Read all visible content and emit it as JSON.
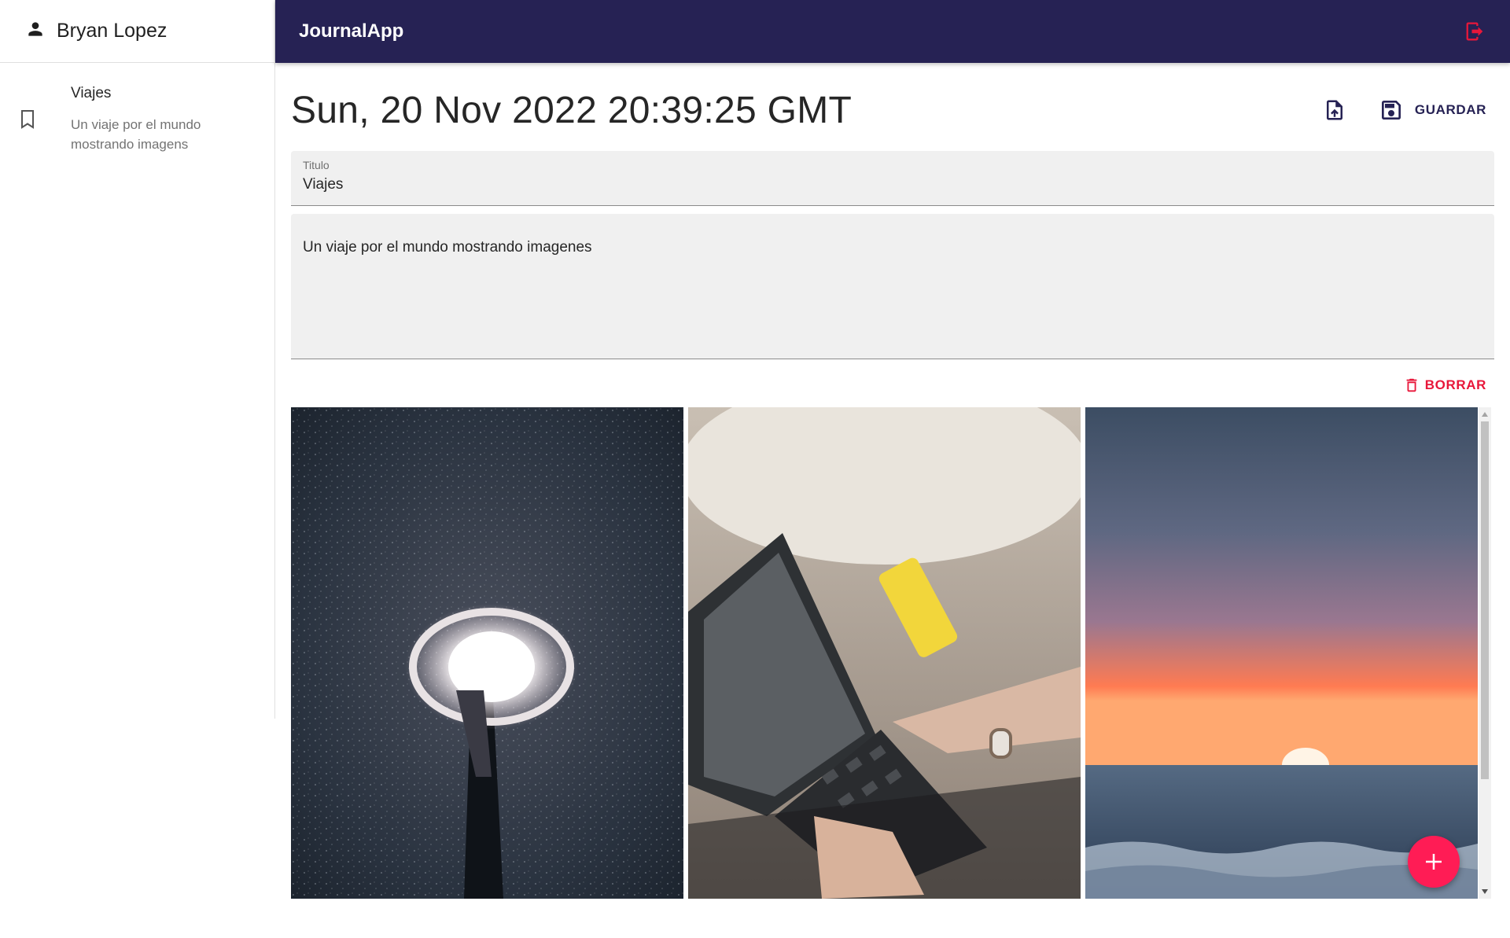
{
  "sidebar": {
    "user_name": "Bryan Lopez",
    "user_icon": "person-icon",
    "entries": [
      {
        "title": "Viajes",
        "body": "Un viaje por el mundo mostrando imagens",
        "icon": "bookmark-icon"
      }
    ]
  },
  "appbar": {
    "title": "JournalApp",
    "logout_icon": "logout-icon",
    "background": "#262254",
    "accent": "#e8173a"
  },
  "note": {
    "date": "Sun, 20 Nov 2022 20:39:25 GMT",
    "upload_icon": "upload-file-icon",
    "save_label": "GUARDAR",
    "title_label": "Titulo",
    "title_value": "Viajes",
    "body_value": "Un viaje por el mundo mostrando imagenes",
    "delete_label": "BORRAR"
  },
  "gallery": {
    "images": [
      {
        "name": "street-lamp-photo"
      },
      {
        "name": "laptop-phone-photo"
      },
      {
        "name": "sunset-ocean-photo"
      }
    ]
  },
  "fab": {
    "icon": "add-icon",
    "color": "#ff1c55"
  }
}
